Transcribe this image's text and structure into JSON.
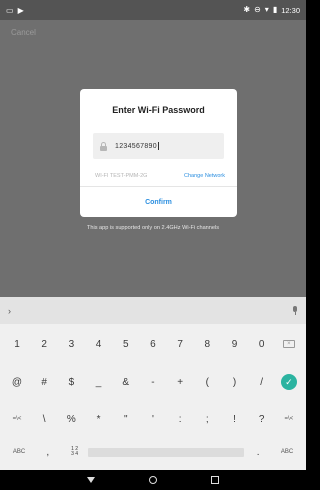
{
  "status_bar": {
    "time": "12:30",
    "left_icons": [
      "screen-icon",
      "play-store-icon"
    ],
    "right_icons": [
      "bluetooth-icon",
      "do-not-disturb-icon",
      "wifi-icon",
      "battery-icon"
    ]
  },
  "app": {
    "cancel_label": "Cancel",
    "note": "This app is supported only on 2.4GHz Wi-Fi channels"
  },
  "dialog": {
    "title": "Enter Wi-Fi Password",
    "password_value": "1234567890",
    "network_name": "WI-FI TEST-PMM-2G",
    "change_network_label": "Change Network",
    "confirm_label": "Confirm",
    "accent": "#2c8fe0"
  },
  "keyboard": {
    "row1": [
      "1",
      "2",
      "3",
      "4",
      "5",
      "6",
      "7",
      "8",
      "9",
      "0"
    ],
    "row2": [
      "@",
      "#",
      "$",
      "_",
      "&",
      "-",
      "+",
      "(",
      ")",
      "/"
    ],
    "row3": [
      "=\\<",
      "\\",
      "%",
      "*",
      "\"",
      "'",
      ":",
      ";",
      "!",
      "?",
      "=\\<"
    ],
    "row4": {
      "left": "ABC",
      "comma": ",",
      "fraction": "1 2\n3 4",
      "period": ".",
      "right": "ABC"
    },
    "enter_color": "#2bb3a0"
  }
}
